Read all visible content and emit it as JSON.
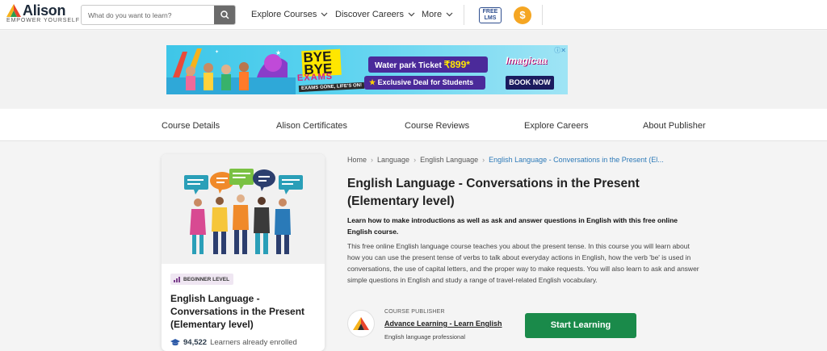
{
  "header": {
    "logo_name": "Alison",
    "logo_tagline": "EMPOWER YOURSELF",
    "search_placeholder": "What do you want to learn?",
    "nav": [
      {
        "label": "Explore Courses"
      },
      {
        "label": "Discover Careers"
      },
      {
        "label": "More"
      }
    ],
    "lms_label": "FREE LMS",
    "coin_symbol": "$"
  },
  "ad": {
    "headline": "BYE BYE",
    "subhead": "EXAMS",
    "tagline": "EXAMS GONE, LIFE'S ON!",
    "offer_text": "Water park Ticket",
    "offer_price": "₹899*",
    "deal_text": "Exclusive Deal for Students",
    "brand": "Imagicaa",
    "cta": "BOOK NOW"
  },
  "subnav": [
    {
      "label": "Course Details"
    },
    {
      "label": "Alison Certificates"
    },
    {
      "label": "Course Reviews"
    },
    {
      "label": "Explore Careers"
    },
    {
      "label": "About Publisher"
    }
  ],
  "card": {
    "level_badge": "BEGINNER LEVEL",
    "title": "English Language - Conversations in the Present (Elementary level)",
    "enrolled_count": "94,522",
    "enrolled_label": "Learners already enrolled"
  },
  "breadcrumb": [
    "Home",
    "Language",
    "English Language",
    "English Language - Conversations in the Present (El..."
  ],
  "course": {
    "title": "English Language - Conversations in the Present (Elementary level)",
    "lead": "Learn how to make introductions as well as ask and answer questions in English with this free online English course.",
    "description": "This free online English language course teaches you about the present tense. In this course you will learn about how you can use the present tense of verbs to talk about everyday actions in English, how the verb 'be' is used in conversations, the use of capital letters, and the proper way to make requests. You will also learn to ask and answer simple questions in English and study a range of travel-related English vocabulary."
  },
  "publisher": {
    "label": "COURSE PUBLISHER",
    "name": "Advance Learning - Learn English",
    "subtitle": "English language professional"
  },
  "cta": {
    "label": "Start Learning"
  },
  "colors": {
    "primary_green": "#1a8a4a",
    "link_blue": "#2d7ab8",
    "coin_orange": "#f5a623",
    "badge_bg": "#efe6f2"
  }
}
